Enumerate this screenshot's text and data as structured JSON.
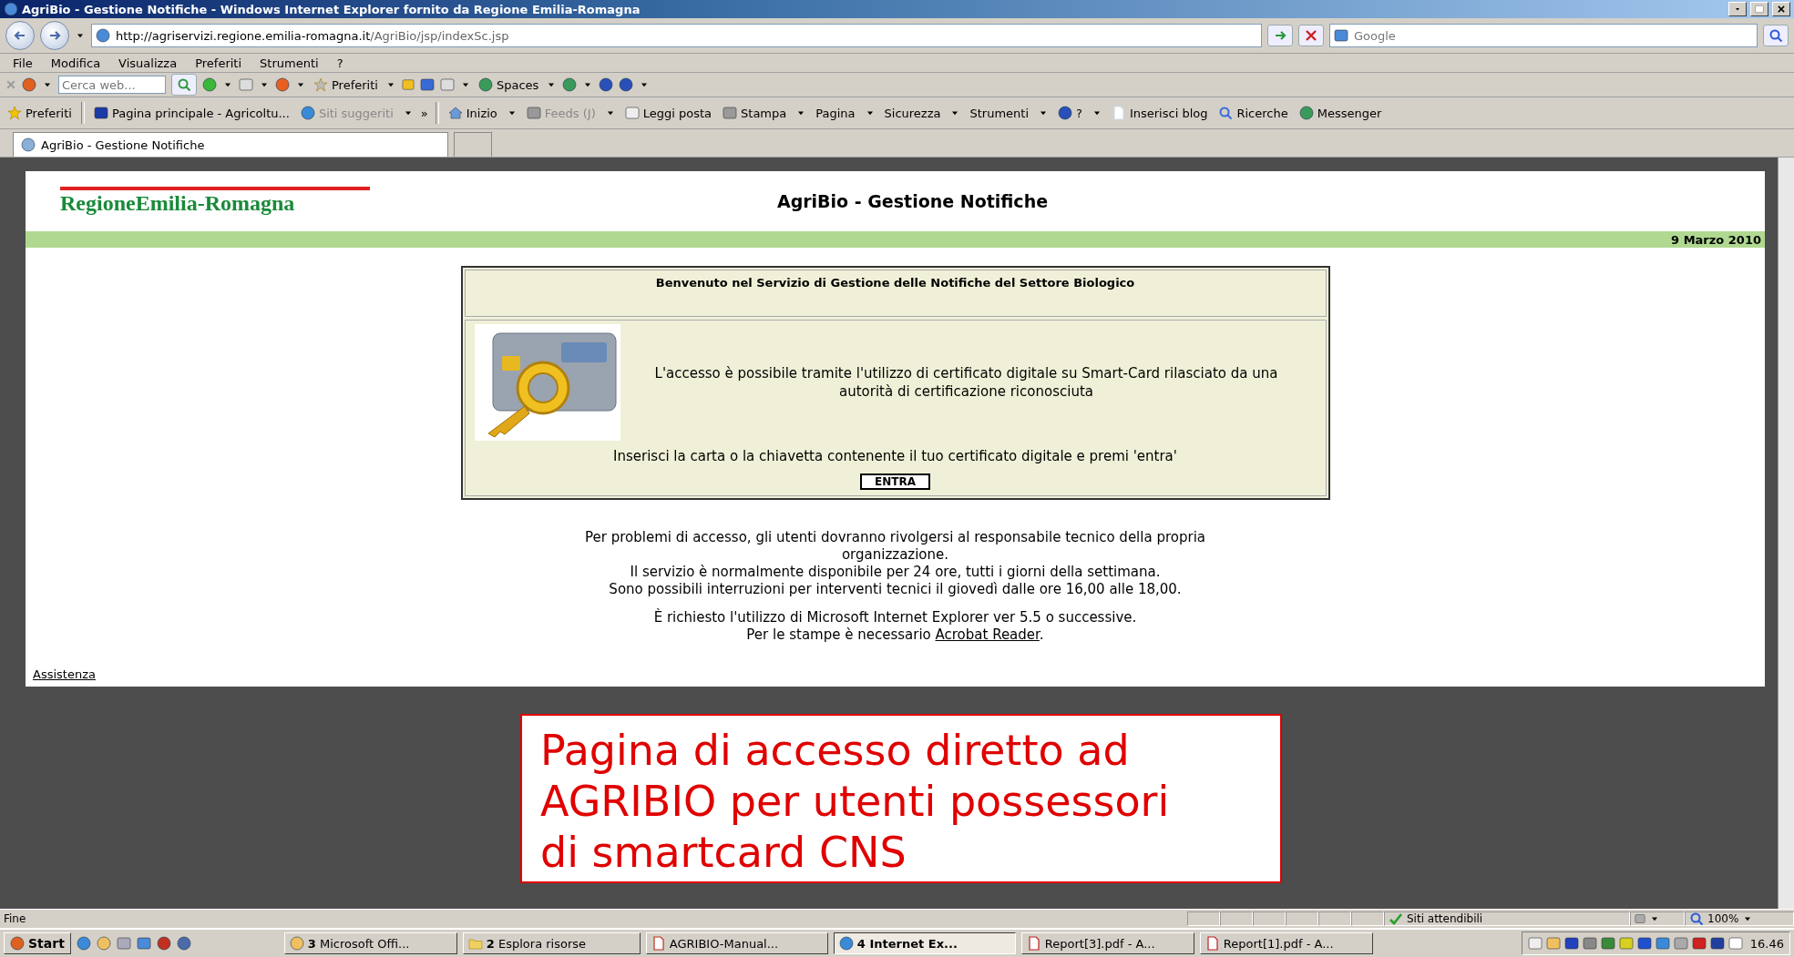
{
  "window": {
    "title": "AgriBio - Gestione Notifiche - Windows Internet Explorer fornito da Regione Emilia-Romagna"
  },
  "address_bar": {
    "url_host": "http://agriservizi.regione.emilia-romagna.it",
    "url_path": "/AgriBio/jsp/indexSc.jsp",
    "search_placeholder": "Google"
  },
  "menu": [
    "File",
    "Modifica",
    "Visualizza",
    "Preferiti",
    "Strumenti",
    "?"
  ],
  "toolbar": {
    "search_placeholder": "Cerca web...",
    "items": [
      "Preferiti",
      "Spaces"
    ]
  },
  "favorites_bar": {
    "items": [
      {
        "label": "Preferiti",
        "disabled": false
      },
      {
        "label": "Pagina principale - Agricoltu...",
        "disabled": false
      },
      {
        "label": "Siti suggeriti",
        "disabled": true
      }
    ],
    "overflow": "»",
    "commands": [
      {
        "label": "Inizio",
        "disabled": false
      },
      {
        "label": "Feeds (J)",
        "disabled": true
      },
      {
        "label": "Leggi posta",
        "disabled": false
      },
      {
        "label": "Stampa",
        "disabled": false
      },
      {
        "label": "Pagina",
        "disabled": false
      },
      {
        "label": "Sicurezza",
        "disabled": false
      },
      {
        "label": "Strumenti",
        "disabled": false
      },
      {
        "label": "?",
        "disabled": false
      },
      {
        "label": "Inserisci blog",
        "disabled": false
      },
      {
        "label": "Ricerche",
        "disabled": false
      },
      {
        "label": "Messenger",
        "disabled": false
      }
    ]
  },
  "tabs": [
    {
      "label": "AgriBio - Gestione Notifiche",
      "selected": true
    }
  ],
  "page": {
    "logo": "RegioneEmilia-Romagna",
    "title": "AgriBio - Gestione Notifiche",
    "date": "9 Marzo 2010",
    "box": {
      "heading": "Benvenuto nel Servizio di Gestione delle Notifiche del Settore Biologico",
      "access_text": "L'accesso è possibile tramite l'utilizzo di certificato digitale su Smart-Card rilasciato da una autorità di certificazione riconosciuta",
      "instruction": "Inserisci la carta o la chiavetta contenente il tuo certificato digitale e premi 'entra'",
      "button": "ENTRA"
    },
    "notes": [
      "Per problemi di accesso, gli utenti dovranno rivolgersi al responsabile tecnico della propria organizzazione.",
      "Il servizio è normalmente disponibile per 24 ore, tutti i giorni della settimana.",
      "Sono possibili interruzioni per interventi tecnici il giovedì dalle ore 16,00 alle 18,00."
    ],
    "requirement": "È richiesto l'utilizzo di Microsoft Internet Explorer ver 5.5 o successive.",
    "print_note": {
      "text": "Per le stampe è necessario ",
      "link": "Acrobat Reader",
      "after": "."
    },
    "assistance": "Assistenza"
  },
  "callout": {
    "text": "Pagina di accesso diretto ad AGRIBIO per utenti possessori di smartcard CNS"
  },
  "status_bar": {
    "text": "Fine",
    "zone": "Siti attendibili",
    "zoom": "100%"
  },
  "taskbar": {
    "start": "Start",
    "tasks": [
      {
        "label": "**3** Microsoft Offi...",
        "selected": false
      },
      {
        "label": "**2** Esplora risorse",
        "selected": false
      },
      {
        "label": "AGRIBIO-Manual...",
        "selected": false
      },
      {
        "label": "4 Internet Ex...",
        "selected": true
      },
      {
        "label": "Report[3].pdf - A...",
        "selected": false
      },
      {
        "label": "Report[1].pdf - A...",
        "selected": false
      }
    ],
    "clock": "16.46"
  }
}
